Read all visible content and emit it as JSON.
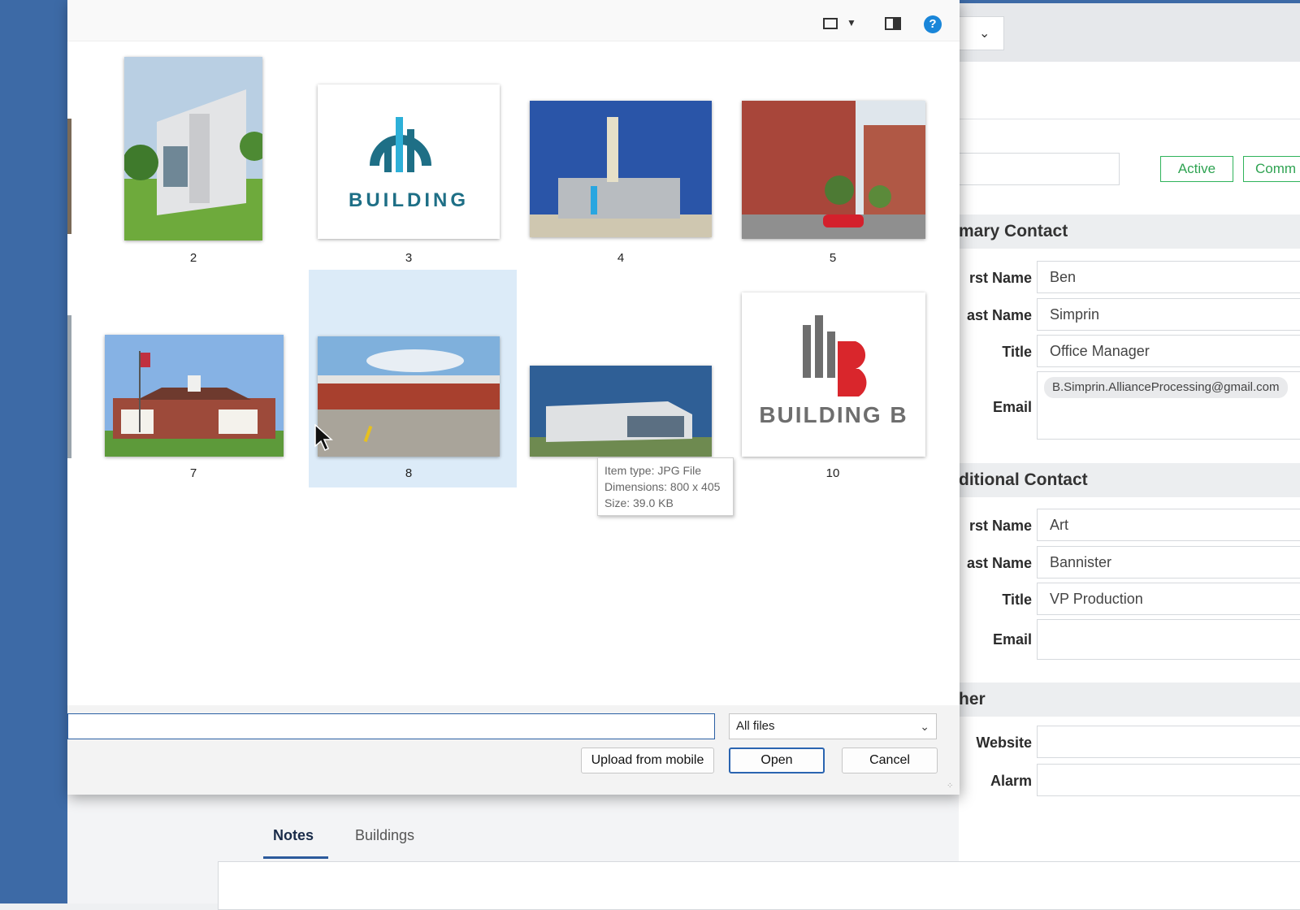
{
  "app": {
    "status_active": "Active",
    "status_comm": "Comm",
    "primary_section": "mary Contact",
    "primary": {
      "first_label": "rst Name",
      "first_value": "Ben",
      "last_label": "ast Name",
      "last_value": "Simprin",
      "title_label": "Title",
      "title_value": "Office Manager",
      "email_label": "Email",
      "email_value": "B.Simprin.AllianceProcessing@gmail.com"
    },
    "additional_section": "ditional Contact",
    "additional": {
      "first_label": "rst Name",
      "first_value": "Art",
      "last_label": "ast Name",
      "last_value": "Bannister",
      "title_label": "Title",
      "title_value": "VP Production",
      "email_label": "Email",
      "email_value": ""
    },
    "other_section": "her",
    "other": {
      "website_label": "Website",
      "alarm_label": "Alarm"
    },
    "tabs": [
      {
        "label": "Notes"
      },
      {
        "label": "Buildings"
      }
    ]
  },
  "dialog": {
    "icons": [
      "view-icon",
      "chevron-down-icon",
      "preview-pane-icon",
      "help-icon"
    ],
    "help_glyph": "?",
    "files": [
      {
        "label": "2"
      },
      {
        "label": "3"
      },
      {
        "label": "4"
      },
      {
        "label": "5"
      },
      {
        "label": "7"
      },
      {
        "label": "8"
      },
      {
        "label": "10"
      }
    ],
    "logo1_text": "BUILDING",
    "logo2_text": "BUILDING B",
    "tooltip": {
      "type": "Item type: JPG File",
      "dimensions": "Dimensions: 800 x 405",
      "size": "Size: 39.0 KB"
    },
    "filename_value": "",
    "filetype": "All files",
    "upload_label": "Upload from mobile",
    "open_label": "Open",
    "cancel_label": "Cancel"
  }
}
